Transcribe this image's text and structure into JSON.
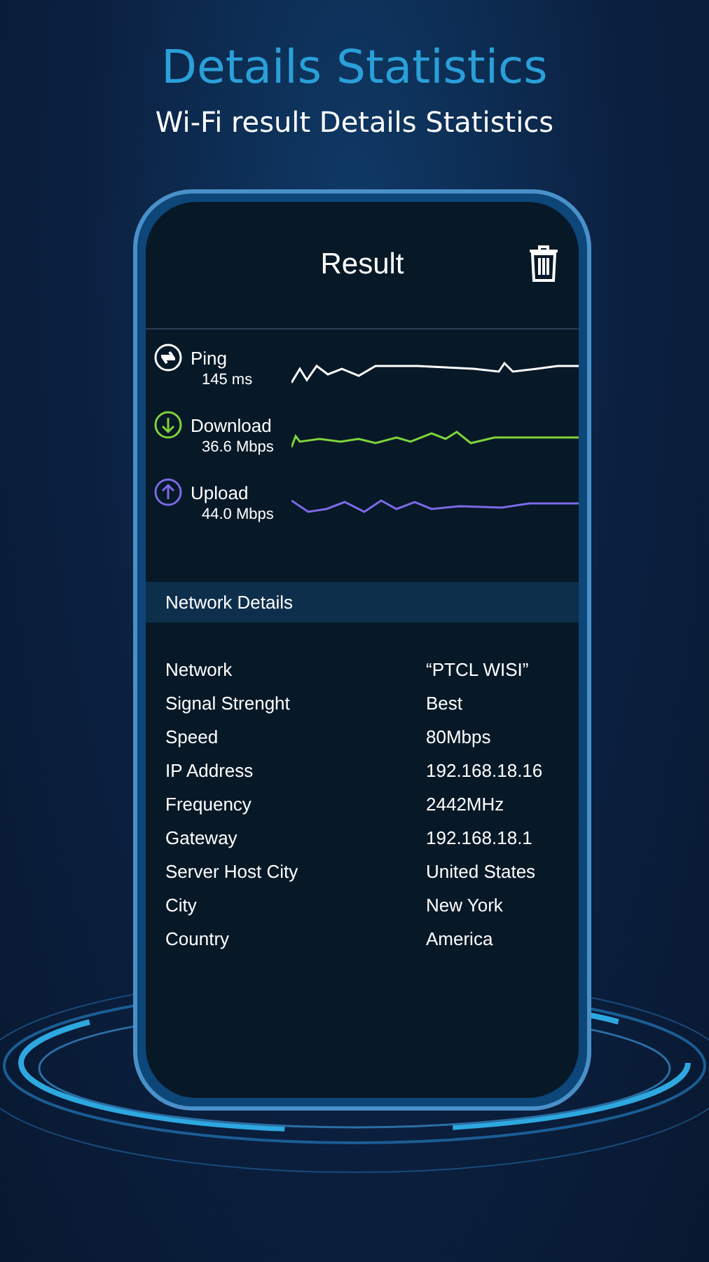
{
  "headline": "Details Statistics",
  "subtitle": "Wi-Fi result Details Statistics",
  "screen": {
    "title": "Result",
    "metrics": [
      {
        "kind": "ping",
        "label": "Ping",
        "value": "145 ms",
        "color": "#ffffff"
      },
      {
        "kind": "download",
        "label": "Download",
        "value": "36.6 Mbps",
        "color": "#7ed33a"
      },
      {
        "kind": "upload",
        "label": "Upload",
        "value": "44.0 Mbps",
        "color": "#7b6ae6"
      }
    ],
    "details_title": "Network Details",
    "details": [
      {
        "label": "Network",
        "value": "“PTCL WISI”"
      },
      {
        "label": "Signal Strenght",
        "value": "Best"
      },
      {
        "label": "Speed",
        "value": "80Mbps"
      },
      {
        "label": "IP Address",
        "value": "192.168.18.16"
      },
      {
        "label": "Frequency",
        "value": "2442MHz"
      },
      {
        "label": "Gateway",
        "value": "192.168.18.1"
      },
      {
        "label": "Server Host City",
        "value": "United States"
      },
      {
        "label": "City",
        "value": "New York"
      },
      {
        "label": "Country",
        "value": "America"
      }
    ]
  }
}
